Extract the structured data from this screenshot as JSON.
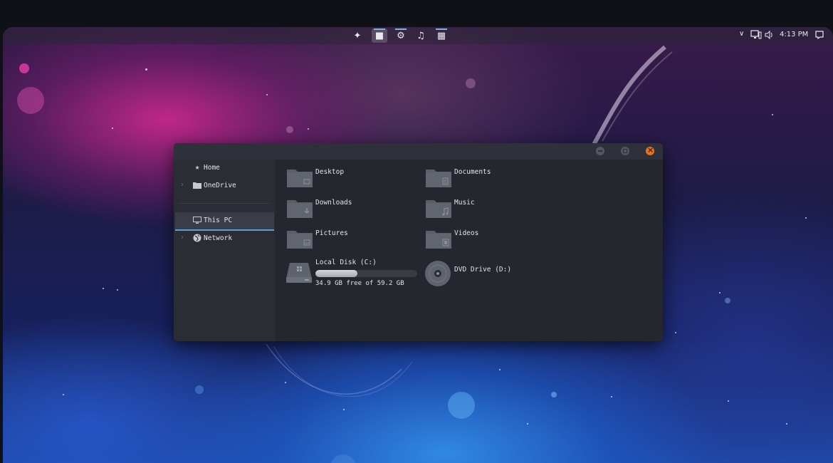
{
  "taskbar": {
    "apps": [
      {
        "name": "ubuntu-logo-icon",
        "glyph": "✦",
        "active": false
      },
      {
        "name": "folder-icon",
        "glyph": "■",
        "active": true
      },
      {
        "name": "settings-gear-icon",
        "glyph": "⚙",
        "active": false
      },
      {
        "name": "music-note-icon",
        "glyph": "♫",
        "active": false
      },
      {
        "name": "equalizer-app-icon",
        "glyph": "▦",
        "active": false
      }
    ],
    "tray": {
      "chevron": "∨",
      "network_icon": "network-icon",
      "volume_icon": "volume-icon",
      "time": "4:13 PM",
      "notification_icon": "notification-icon"
    }
  },
  "window": {
    "sidebar": {
      "items": [
        {
          "label": "Home",
          "icon": "star-icon",
          "has_chevron": false,
          "selected": false
        },
        {
          "label": "OneDrive",
          "icon": "folder-icon",
          "has_chevron": true,
          "selected": false
        },
        {
          "label": "This PC",
          "icon": "computer-icon",
          "has_chevron": false,
          "selected": true
        },
        {
          "label": "Network",
          "icon": "globe-icon",
          "has_chevron": true,
          "selected": false
        }
      ]
    },
    "folders": [
      {
        "label": "Desktop",
        "icon": "desktop-folder-icon"
      },
      {
        "label": "Documents",
        "icon": "documents-folder-icon"
      },
      {
        "label": "Downloads",
        "icon": "downloads-folder-icon"
      },
      {
        "label": "Music",
        "icon": "music-folder-icon"
      },
      {
        "label": "Pictures",
        "icon": "pictures-folder-icon"
      },
      {
        "label": "Videos",
        "icon": "videos-folder-icon"
      }
    ],
    "drives": [
      {
        "label": "Local Disk (C:)",
        "free_text": "34.9 GB free of 59.2 GB",
        "used_fraction": 0.41,
        "icon": "hard-drive-icon"
      },
      {
        "label": "DVD Drive (D:)",
        "icon": "dvd-disc-icon"
      }
    ]
  },
  "colors": {
    "accent": "#5e9fe0",
    "close_button": "#e8721c",
    "window_bg": "#25272f",
    "sidebar_bg": "#2b2d35",
    "folder_icon": "#5a5e69"
  }
}
